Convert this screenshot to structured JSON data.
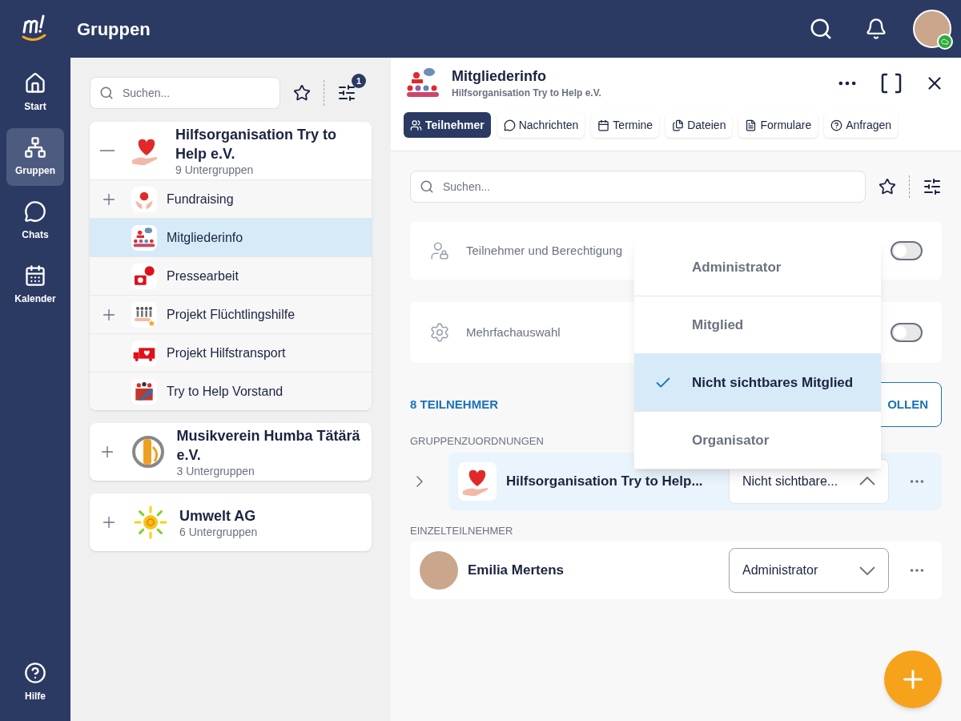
{
  "app": {
    "title": "Gruppen"
  },
  "nav": [
    {
      "label": "Start",
      "selected": false
    },
    {
      "label": "Gruppen",
      "selected": true
    },
    {
      "label": "Chats",
      "selected": false
    },
    {
      "label": "Kalender",
      "selected": false
    }
  ],
  "nav_bottom": {
    "label": "Hilfe"
  },
  "left": {
    "search": {
      "placeholder": "Suchen..."
    },
    "filter_badge": "1",
    "groups": [
      {
        "name": "Hilfsorganisation Try to Help e.V.",
        "subtitle": "9 Untergruppen",
        "expanded": true,
        "kind": "heart",
        "children": [
          {
            "name": "Fundraising",
            "expandable": true,
            "selected": false,
            "kind": "money"
          },
          {
            "name": "Mitgliederinfo",
            "expandable": false,
            "selected": true,
            "kind": "people"
          },
          {
            "name": "Pressearbeit",
            "expandable": false,
            "selected": false,
            "kind": "camera"
          },
          {
            "name": "Projekt Flüchtlingshilfe",
            "expandable": true,
            "selected": false,
            "kind": "family"
          },
          {
            "name": "Projekt Hilfstransport",
            "expandable": false,
            "selected": false,
            "kind": "truck"
          },
          {
            "name": "Try to Help Vorstand",
            "expandable": false,
            "selected": false,
            "kind": "board"
          }
        ]
      },
      {
        "name": "Musikverein Humba Tätärä e.V.",
        "subtitle": "3 Untergruppen",
        "expanded": false,
        "kind": "music"
      },
      {
        "name": "Umwelt AG",
        "subtitle": "6 Untergruppen",
        "expanded": false,
        "kind": "sun"
      }
    ]
  },
  "detail": {
    "title": "Mitgliederinfo",
    "subtitle": "Hilfsorganisation Try to Help e.V.",
    "tabs": [
      {
        "label": "Teilnehmer",
        "selected": true
      },
      {
        "label": "Nachrichten",
        "selected": false
      },
      {
        "label": "Termine",
        "selected": false
      },
      {
        "label": "Dateien",
        "selected": false
      },
      {
        "label": "Formulare",
        "selected": false
      },
      {
        "label": "Anfragen",
        "selected": false
      }
    ],
    "search": {
      "placeholder": "Suchen..."
    },
    "settings": [
      {
        "label": "Teilnehmer und Berechtigung",
        "on": false
      },
      {
        "label": "Mehrfachauswahl",
        "on": false
      }
    ],
    "count": "8 TEILNEHMER",
    "action_button": "OLLEN",
    "group_section": "GRUPPENZUORDNUNGEN",
    "group_row": {
      "name": "Hilfsorganisation Try to Help...",
      "role": "Nicht sichtbare...",
      "open": true
    },
    "single_section": "EINZELTEILNEHMER",
    "person_row": {
      "name": "Emilia Mertens",
      "role": "Administrator",
      "open": false
    },
    "role_menu": [
      {
        "label": "Administrator",
        "selected": false
      },
      {
        "label": "Mitglied",
        "selected": false
      },
      {
        "label": "Nicht sichtbares Mitglied",
        "selected": true
      },
      {
        "label": "Organisator",
        "selected": false
      }
    ]
  }
}
